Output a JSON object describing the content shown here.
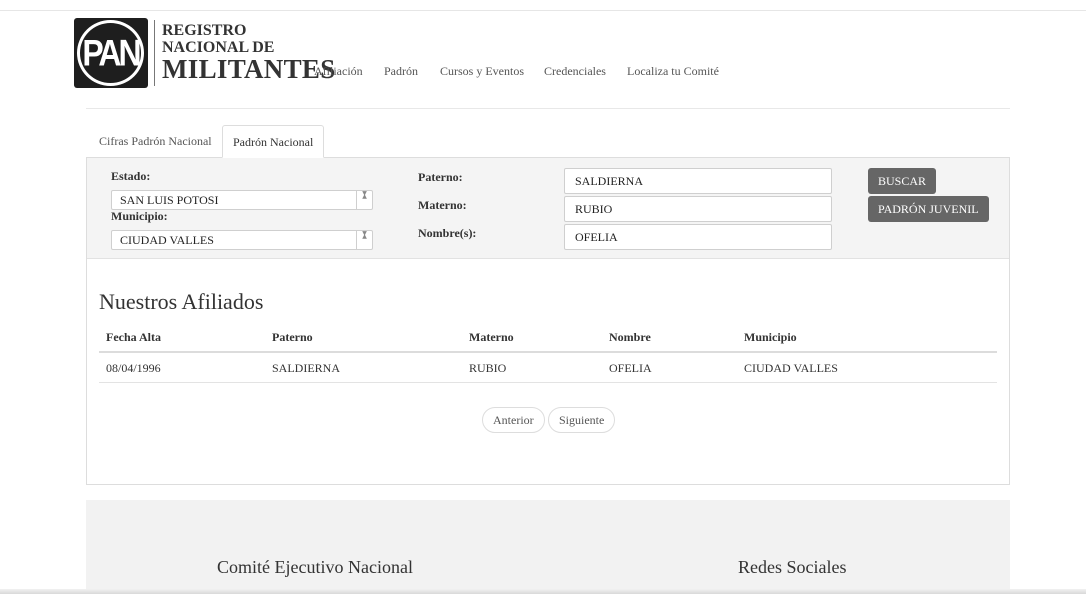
{
  "brand": {
    "logo": "PAN",
    "line1": "REGISTRO",
    "line2": "NACIONAL DE",
    "line3": "MILITANTES"
  },
  "nav": [
    "Afiliación",
    "Padrón",
    "Cursos y Eventos",
    "Credenciales",
    "Localiza tu Comité"
  ],
  "tabs": [
    "Cifras Padrón Nacional",
    "Padrón Nacional"
  ],
  "search": {
    "estado_label": "Estado:",
    "estado_value": "SAN LUIS POTOSI",
    "municipio_label": "Municipio:",
    "municipio_value": "CIUDAD VALLES",
    "paterno_label": "Paterno:",
    "paterno_value": "SALDIERNA",
    "materno_label": "Materno:",
    "materno_value": "RUBIO",
    "nombre_label": "Nombre(s):",
    "nombre_value": "OFELIA",
    "buscar": "BUSCAR",
    "juvenil": "PADRÓN JUVENIL"
  },
  "results": {
    "title": "Nuestros Afiliados",
    "columns": [
      "Fecha Alta",
      "Paterno",
      "Materno",
      "Nombre",
      "Municipio"
    ],
    "rows": [
      [
        "08/04/1996",
        "SALDIERNA",
        "RUBIO",
        "OFELIA",
        "CIUDAD VALLES"
      ]
    ],
    "prev": "Anterior",
    "next": "Siguiente"
  },
  "footer": {
    "left": "Comité Ejecutivo Nacional",
    "right": "Redes Sociales"
  }
}
